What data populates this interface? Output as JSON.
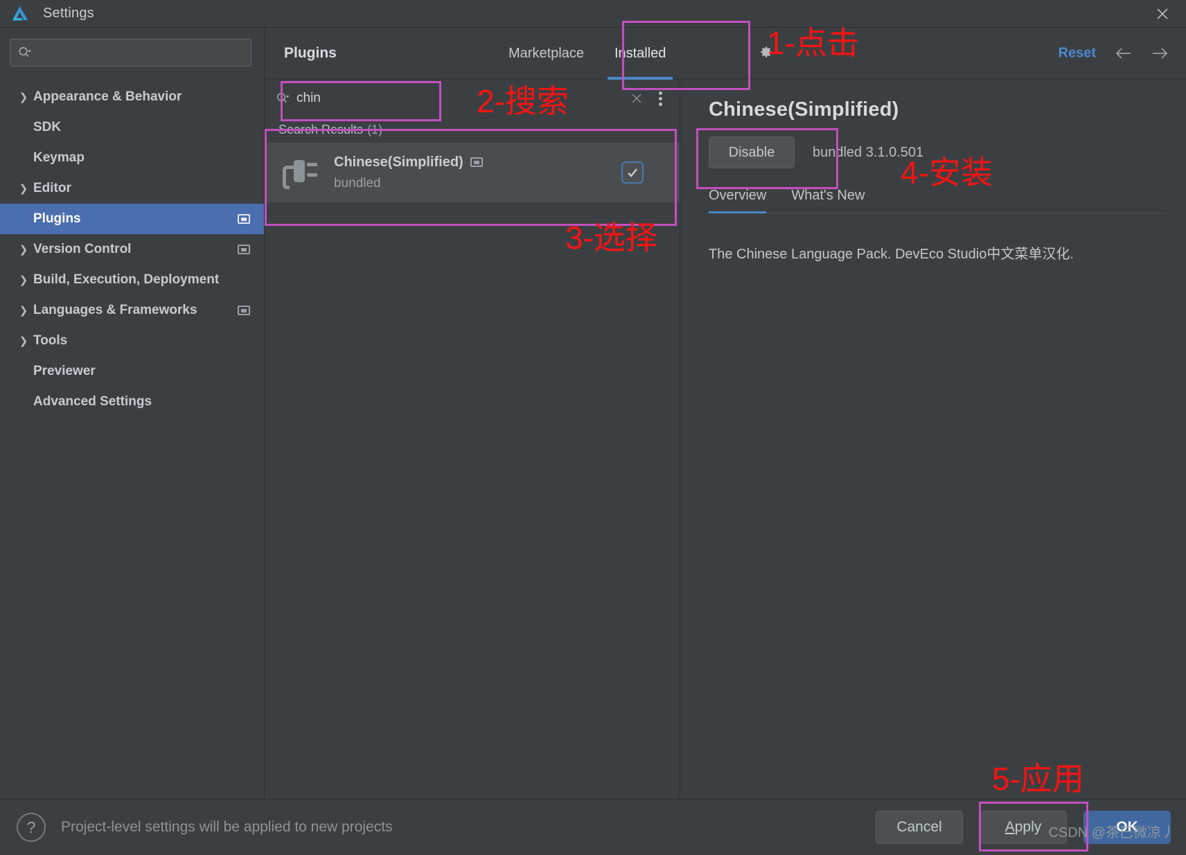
{
  "window": {
    "title": "Settings",
    "logo_icon": "deveco-logo-icon",
    "close_icon": "close-icon"
  },
  "sidebar": {
    "search": {
      "placeholder": "",
      "value": "",
      "icon": "search-icon"
    },
    "items": [
      {
        "label": "Appearance & Behavior",
        "expandable": true,
        "selected": false,
        "flag": false
      },
      {
        "label": "SDK",
        "expandable": false,
        "selected": false,
        "flag": false
      },
      {
        "label": "Keymap",
        "expandable": false,
        "selected": false,
        "flag": false
      },
      {
        "label": "Editor",
        "expandable": true,
        "selected": false,
        "flag": false
      },
      {
        "label": "Plugins",
        "expandable": false,
        "selected": true,
        "flag": true
      },
      {
        "label": "Version Control",
        "expandable": true,
        "selected": false,
        "flag": true
      },
      {
        "label": "Build, Execution, Deployment",
        "expandable": true,
        "selected": false,
        "flag": false
      },
      {
        "label": "Languages & Frameworks",
        "expandable": true,
        "selected": false,
        "flag": true
      },
      {
        "label": "Tools",
        "expandable": true,
        "selected": false,
        "flag": false
      },
      {
        "label": "Previewer",
        "expandable": false,
        "selected": false,
        "flag": false
      },
      {
        "label": "Advanced Settings",
        "expandable": false,
        "selected": false,
        "flag": false
      }
    ]
  },
  "main": {
    "header": {
      "title": "Plugins",
      "tabs": [
        {
          "label": "Marketplace",
          "active": false
        },
        {
          "label": "Installed",
          "active": true
        }
      ],
      "gear_icon": "gear-icon",
      "reset_label": "Reset",
      "back_icon": "arrow-left-icon",
      "forward_icon": "arrow-right-icon"
    },
    "plugin_search": {
      "value": "chin",
      "placeholder": "",
      "search_icon": "search-icon",
      "clear_icon": "close-icon",
      "menu_icon": "kebab-menu-icon"
    },
    "results": {
      "header_label": "Search Results",
      "header_count": "(1)",
      "rows": [
        {
          "name": "Chinese(Simplified)",
          "subtitle": "bundled",
          "icon": "plugin-plug-icon",
          "flag_icon": "project-level-icon",
          "enabled": true
        }
      ]
    },
    "detail": {
      "title": "Chinese(Simplified)",
      "disable_label": "Disable",
      "version_label": "bundled 3.1.0.501",
      "tabs": [
        {
          "label": "Overview",
          "active": true
        },
        {
          "label": "What's New",
          "active": false
        }
      ],
      "description": "The Chinese Language Pack. DevEco Studio中文菜单汉化."
    }
  },
  "bottom": {
    "help_icon": "help-icon",
    "note": "Project-level settings will be applied to new projects",
    "cancel_label": "Cancel",
    "apply_label": "Apply",
    "apply_mnemonic": "A",
    "apply_rest": "pply",
    "ok_label": "OK"
  },
  "annotations": {
    "color_box": "#c34fc0",
    "color_text": "#f41414",
    "steps": [
      {
        "id": "step-1",
        "text": "1-点击"
      },
      {
        "id": "step-2",
        "text": "2-搜索"
      },
      {
        "id": "step-3",
        "text": "3-选择"
      },
      {
        "id": "step-4",
        "text": "4-安装"
      },
      {
        "id": "step-5",
        "text": "5-应用"
      }
    ]
  },
  "watermark": {
    "text": "CSDN @茶巳微凉丿"
  }
}
